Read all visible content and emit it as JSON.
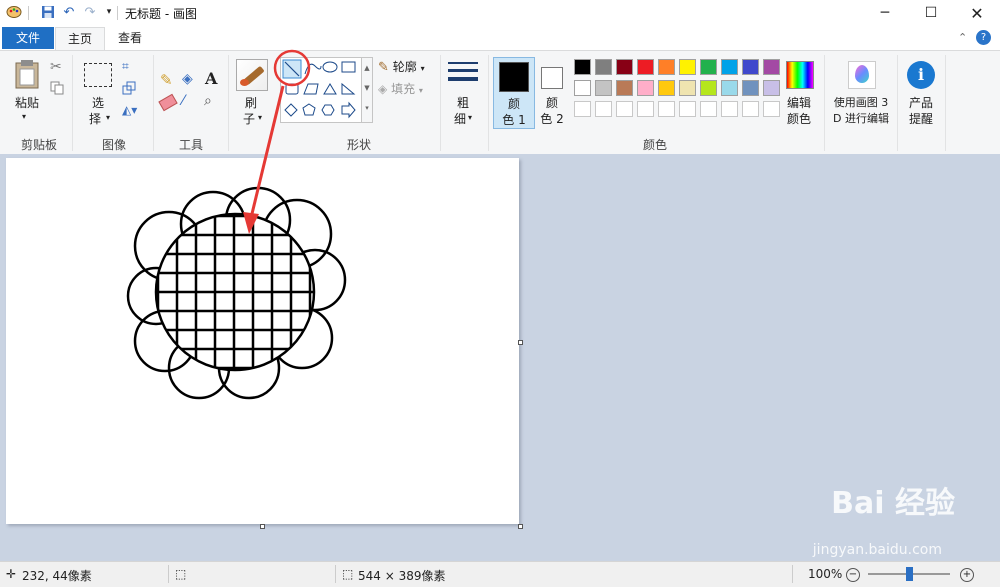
{
  "titlebar": {
    "title": "无标题 - 画图"
  },
  "tabs": [
    {
      "label": "文件"
    },
    {
      "label": "主页"
    },
    {
      "label": "查看"
    }
  ],
  "ribbon": {
    "clipboard": {
      "paste_label": "粘贴",
      "group_label": "剪贴板"
    },
    "image": {
      "select_label": "选",
      "select_label2": "择",
      "group_label": "图像"
    },
    "tools": {
      "group_label": "工具"
    },
    "brush": {
      "label": "刷",
      "label2": "子"
    },
    "shapes": {
      "outline_label": "轮廓",
      "fill_label": "填充",
      "group_label": "形状"
    },
    "size": {
      "label": "粗",
      "label2": "细"
    },
    "colors": {
      "color1_label": "颜",
      "color1_label2": "色 1",
      "color2_label": "颜",
      "color2_label2": "色 2",
      "edit_label": "编辑",
      "edit_label2": "颜色",
      "group_label": "颜色",
      "palette_row1": [
        "#000000",
        "#7f7f7f",
        "#880015",
        "#ed1c24",
        "#ff7f27",
        "#fff200",
        "#22b14c",
        "#00a2e8",
        "#3f48cc",
        "#a349a4"
      ],
      "palette_row2": [
        "#ffffff",
        "#c3c3c3",
        "#b97a57",
        "#ffaec9",
        "#ffc90e",
        "#efe4b0",
        "#b5e61d",
        "#99d9ea",
        "#7092be",
        "#c8bfe7"
      ],
      "color1": "#000000",
      "color2": "#ffffff"
    },
    "paint3d": {
      "label": "使用画图 3",
      "label2": "D 进行编辑"
    },
    "product": {
      "label": "产品",
      "label2": "提醒"
    }
  },
  "status": {
    "cursor_pos": "232, 44像素",
    "image_size": "544 × 389像素",
    "zoom": "100%",
    "zoom_level": 0.5
  },
  "watermark": {
    "text": "Bai 经验",
    "sub": "jingyan.baidu.com"
  }
}
